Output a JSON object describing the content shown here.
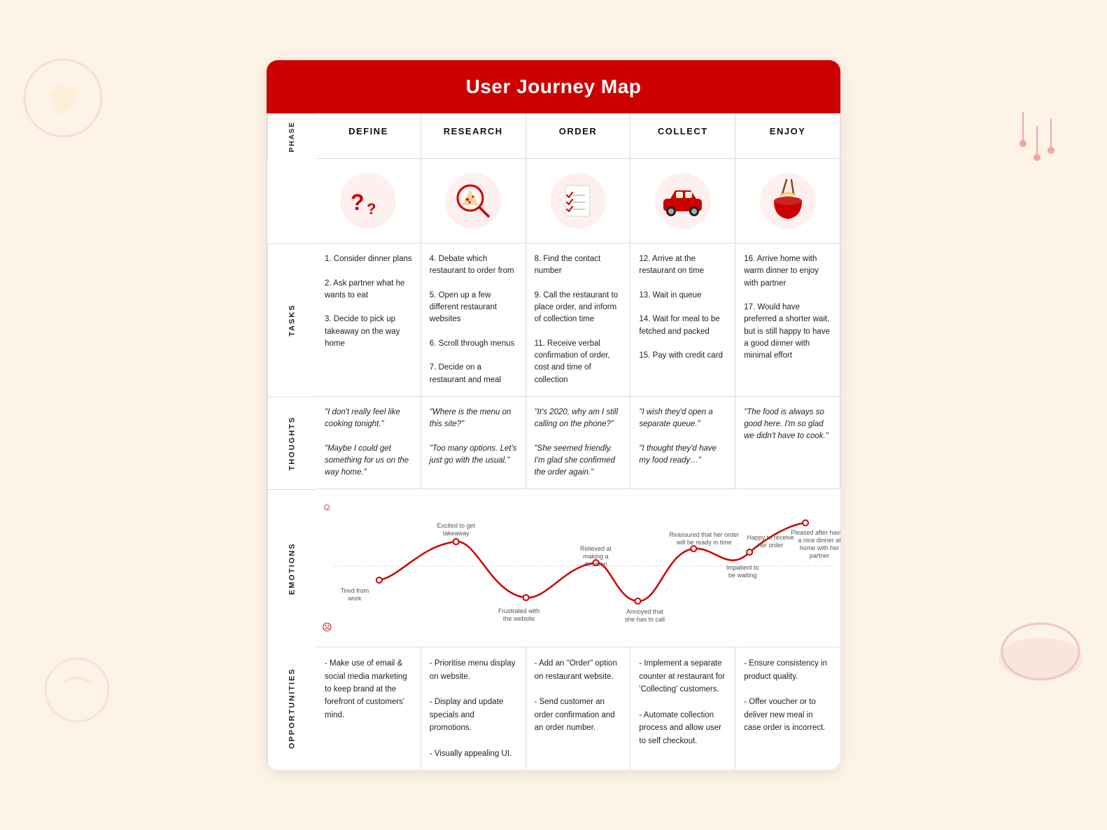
{
  "title": "User Journey Map",
  "columns": [
    {
      "label": "DEFINE"
    },
    {
      "label": "RESEARCH"
    },
    {
      "label": "ORDER"
    },
    {
      "label": "COLLECT"
    },
    {
      "label": "ENJOY"
    }
  ],
  "rows": {
    "phase": {
      "label": "PHASE"
    },
    "tasks": {
      "label": "TASKS",
      "cells": [
        "1. Consider dinner plans\n\n2. Ask partner what he wants to eat\n\n3. Decide to pick up takeaway on the way home",
        "4. Debate which restaurant to order from\n\n5. Open up a few different restaurant websites\n\n6. Scroll through menus\n\n7. Decide on a restaurant and meal",
        "8. Find the contact number\n\n9. Call the restaurant to place order, and inform of collection time\n\n11. Receive verbal confirmation of order, cost and time of collection",
        "12. Arrive at the restaurant on time\n\n13. Wait in queue\n\n14. Wait for meal to be fetched and packed\n\n15. Pay with credit card",
        "16. Arrive home with warm dinner to enjoy with partner\n\n17. Would have preferred a shorter wait, but is still happy to have a good dinner with minimal effort"
      ]
    },
    "thoughts": {
      "label": "THOUGHTS",
      "cells": [
        "\"I don't really feel like cooking tonight.\"\n\n\"Maybe I could get something for us on the way home.\"",
        "\"Where is the menu on this site?\"\n\n\"Too many options. Let's just go with the usual.\"",
        "\"It's 2020, why am I still calling on the phone?\"\n\n\"She seemed friendly. I'm glad she confirmed the order again.\"",
        "\"I wish they'd open a separate queue.\"\n\n\"I thought they'd have my food ready…\"",
        "\"The food is always so good here. I'm so glad we didn't have to cook.\""
      ]
    },
    "emotions": {
      "label": "EMOTIONS"
    },
    "opportunities": {
      "label": "OPPORTUNITIES",
      "cells": [
        "- Make use of email & social media marketing to keep brand at the forefront of customers' mind.",
        "- Prioritise menu display on website.\n\n- Display and update specials and promotions.\n\n- Visually appealing UI.",
        "- Add an \"Order\" option on restaurant website.\n\n- Send customer an order confirmation and an order number.",
        "- Implement a separate counter at restaurant for 'Collecting' customers.\n\n- Automate collection process and allow user to self checkout.",
        "- Ensure consistency in product quality.\n\n- Offer voucher or to deliver new meal in case order is incorrect."
      ]
    }
  }
}
